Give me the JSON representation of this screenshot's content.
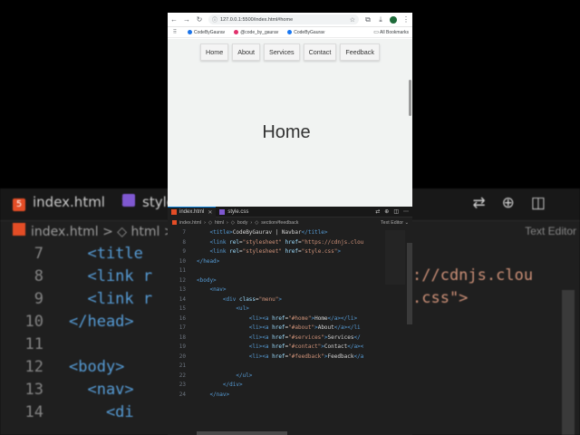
{
  "background_editor": {
    "tabs": [
      {
        "label": "index.html"
      },
      {
        "label": "style"
      }
    ],
    "breadcrumb": [
      "index.html",
      ">",
      "html",
      ">"
    ],
    "right_label": "Text Editor",
    "lines": [
      {
        "n": "7",
        "code": "  <title"
      },
      {
        "n": "8",
        "code": "  <link r"
      },
      {
        "n": "9",
        "code": "  <link r"
      },
      {
        "n": "10",
        "code": "</head>"
      },
      {
        "n": "11",
        "code": ""
      },
      {
        "n": "12",
        "code": "<body>"
      },
      {
        "n": "13",
        "code": "  <nav>"
      },
      {
        "n": "14",
        "code": "    <di"
      }
    ],
    "right_code": [
      "://cdnjs.clou",
      ".css\">"
    ]
  },
  "browser": {
    "url": "127.0.0.1:5500/index.html#home",
    "bookmarks": [
      {
        "label": "CodeByGaurav",
        "color": "#1a73e8"
      },
      {
        "label": "@code_by_gaurav",
        "color": "#e1306c"
      },
      {
        "label": "CodeByGaurav",
        "color": "#1877f2"
      }
    ],
    "all_bookmarks": "All Bookmarks",
    "page": {
      "nav": [
        "Home",
        "About",
        "Services",
        "Contact",
        "Feedback"
      ],
      "hero": "Home"
    }
  },
  "editor": {
    "tabs": [
      {
        "label": "index.html",
        "active": true
      },
      {
        "label": "style.css",
        "active": false
      }
    ],
    "breadcrumb": [
      "index.html",
      "html",
      "body",
      "section#feedback"
    ],
    "text_editor_label": "Text Editor",
    "lines": [
      {
        "n": "7",
        "indent": "    ",
        "parts": [
          [
            "tg",
            "<title>"
          ],
          [
            "tx",
            "CodeByGaurav | Navbar"
          ],
          [
            "tg",
            "</title>"
          ]
        ]
      },
      {
        "n": "8",
        "indent": "    ",
        "parts": [
          [
            "tg",
            "<link "
          ],
          [
            "at",
            "rel"
          ],
          [
            "tx",
            "="
          ],
          [
            "st",
            "\"stylesheet\""
          ],
          [
            "at",
            " href"
          ],
          [
            "tx",
            "="
          ],
          [
            "st",
            "\"https://cdnjs.clou"
          ]
        ]
      },
      {
        "n": "9",
        "indent": "    ",
        "parts": [
          [
            "tg",
            "<link "
          ],
          [
            "at",
            "rel"
          ],
          [
            "tx",
            "="
          ],
          [
            "st",
            "\"stylesheet\""
          ],
          [
            "at",
            " href"
          ],
          [
            "tx",
            "="
          ],
          [
            "st",
            "\"style.css\""
          ],
          [
            "tg",
            ">"
          ]
        ]
      },
      {
        "n": "10",
        "indent": "",
        "parts": [
          [
            "tg",
            "</head>"
          ]
        ]
      },
      {
        "n": "11",
        "indent": "",
        "parts": []
      },
      {
        "n": "12",
        "indent": "",
        "parts": [
          [
            "tg",
            "<body>"
          ]
        ]
      },
      {
        "n": "13",
        "indent": "    ",
        "parts": [
          [
            "tg",
            "<nav>"
          ]
        ]
      },
      {
        "n": "14",
        "indent": "        ",
        "parts": [
          [
            "tg",
            "<div "
          ],
          [
            "at",
            "class"
          ],
          [
            "tx",
            "="
          ],
          [
            "st",
            "\"menu\""
          ],
          [
            "tg",
            ">"
          ]
        ]
      },
      {
        "n": "15",
        "indent": "            ",
        "parts": [
          [
            "tg",
            "<ul>"
          ]
        ]
      },
      {
        "n": "16",
        "indent": "                ",
        "parts": [
          [
            "tg",
            "<li><a "
          ],
          [
            "at",
            "href"
          ],
          [
            "tx",
            "="
          ],
          [
            "st",
            "\"#home\""
          ],
          [
            "tg",
            ">"
          ],
          [
            "tx",
            "Home"
          ],
          [
            "tg",
            "</a></li>"
          ]
        ]
      },
      {
        "n": "17",
        "indent": "                ",
        "parts": [
          [
            "tg",
            "<li><a "
          ],
          [
            "at",
            "href"
          ],
          [
            "tx",
            "="
          ],
          [
            "st",
            "\"#about\""
          ],
          [
            "tg",
            ">"
          ],
          [
            "tx",
            "About"
          ],
          [
            "tg",
            "</a></li"
          ]
        ]
      },
      {
        "n": "18",
        "indent": "                ",
        "parts": [
          [
            "tg",
            "<li><a "
          ],
          [
            "at",
            "href"
          ],
          [
            "tx",
            "="
          ],
          [
            "st",
            "\"#services\""
          ],
          [
            "tg",
            ">"
          ],
          [
            "tx",
            "Services"
          ],
          [
            "tg",
            "</"
          ]
        ]
      },
      {
        "n": "19",
        "indent": "                ",
        "parts": [
          [
            "tg",
            "<li><a "
          ],
          [
            "at",
            "href"
          ],
          [
            "tx",
            "="
          ],
          [
            "st",
            "\"#contact\""
          ],
          [
            "tg",
            ">"
          ],
          [
            "tx",
            "Contact"
          ],
          [
            "tg",
            "</a><"
          ]
        ]
      },
      {
        "n": "20",
        "indent": "                ",
        "parts": [
          [
            "tg",
            "<li><a "
          ],
          [
            "at",
            "href"
          ],
          [
            "tx",
            "="
          ],
          [
            "st",
            "\"#feedback\""
          ],
          [
            "tg",
            ">"
          ],
          [
            "tx",
            "Feedback"
          ],
          [
            "tg",
            "</a"
          ]
        ]
      },
      {
        "n": "21",
        "indent": "",
        "parts": []
      },
      {
        "n": "22",
        "indent": "            ",
        "parts": [
          [
            "tg",
            "</ul>"
          ]
        ]
      },
      {
        "n": "23",
        "indent": "        ",
        "parts": [
          [
            "tg",
            "</div>"
          ]
        ]
      },
      {
        "n": "24",
        "indent": "    ",
        "parts": [
          [
            "tg",
            "</nav>"
          ]
        ]
      }
    ]
  }
}
